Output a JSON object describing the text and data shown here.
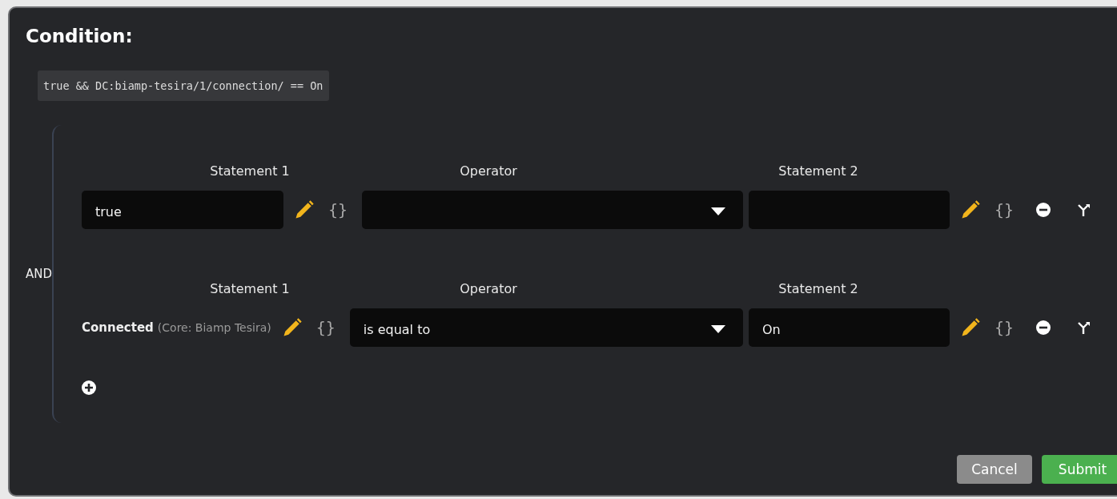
{
  "dialog": {
    "title": "Condition:",
    "expression": "true && DC:biamp-tesira/1/connection/ == On",
    "group": {
      "operator": "AND",
      "rows": [
        {
          "headers": [
            "Statement 1",
            "Operator",
            "Statement 2"
          ],
          "statement1": {
            "kind": "input",
            "value": "true",
            "braces": "{}"
          },
          "operator": {},
          "statement2": {
            "braces": "{}"
          }
        },
        {
          "headers": [
            "Statement 1",
            "Operator",
            "Statement 2"
          ],
          "statement1": {
            "kind": "label",
            "name": "Connected",
            "source": "(Core: Biamp Tesira)",
            "braces": "{}"
          },
          "operator": {
            "value": "is equal to"
          },
          "statement2": {
            "value": "On",
            "braces": "{}"
          }
        }
      ]
    },
    "buttons": [
      {
        "label": "Cancel",
        "kind": "secondary"
      },
      {
        "label": "Submit",
        "kind": "primary"
      }
    ]
  }
}
